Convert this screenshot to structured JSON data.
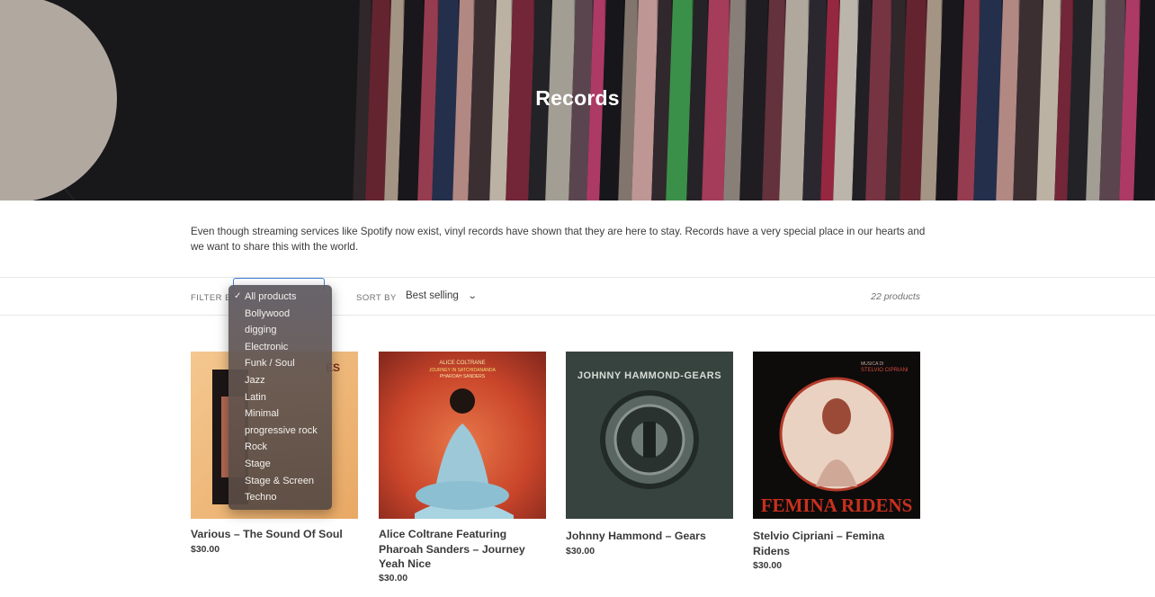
{
  "collection": {
    "title": "Records",
    "description": "Even though streaming services like Spotify now exist, vinyl records have shown that they are here to stay. Records have a very special place in our hearts and we want to share this with the world."
  },
  "filter": {
    "label": "Filter by",
    "options": [
      "All products",
      "Bollywood",
      "digging",
      "Electronic",
      "Funk / Soul",
      "Jazz",
      "Latin",
      "Minimal",
      "progressive rock",
      "Rock",
      "Stage",
      "Stage & Screen",
      "Techno"
    ],
    "selected": "All products",
    "check_glyph": "✓"
  },
  "sort": {
    "label": "Sort by",
    "value": "Best selling",
    "chevron": "⌄"
  },
  "product_count": "22 products",
  "products": [
    {
      "title": "Various – The Sound Of Soul",
      "price": "$30.00",
      "cover_text": "ES"
    },
    {
      "title": "Alice Coltrane Featuring Pharoah Sanders – Journey Yeah Nice",
      "price": "$30.00",
      "cover_text_1": "ALICE COLTRANE",
      "cover_text_2": "JOURNEY IN SATCHIDANANDA",
      "cover_text_3": "PHAROAH SANDERS"
    },
    {
      "title": "Johnny Hammond – Gears",
      "price": "$30.00",
      "cover_text": "JOHNNY HAMMOND-GEARS"
    },
    {
      "title": "Stelvio Cipriani – Femina Ridens",
      "price": "$30.00",
      "cover_text_1": "STELVIO CIPRIANI",
      "cover_text_2": "FEMINA RIDENS",
      "cover_text_3": "MUSICA DI"
    }
  ],
  "colors": {
    "focus_ring": "#3e7fd6",
    "text": "#3a3a3a",
    "dropdown_bg": "#5e5552"
  },
  "icons": {
    "check": "check-icon",
    "sort_chevron": "chevron-down-icon"
  }
}
